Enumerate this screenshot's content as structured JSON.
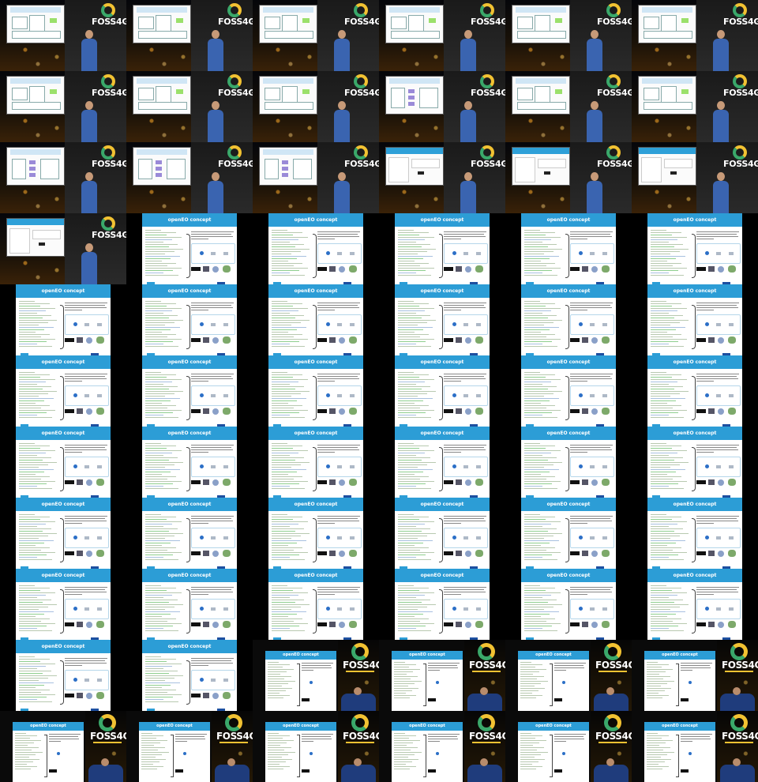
{
  "logo": {
    "text": "FOSS4G"
  },
  "slides": {
    "title": "openEO concept"
  },
  "colors": {
    "slide_header": "#2c9dd6",
    "logo_green": "#3aa86a",
    "logo_yellow": "#f2c232",
    "background": "#000000"
  }
}
